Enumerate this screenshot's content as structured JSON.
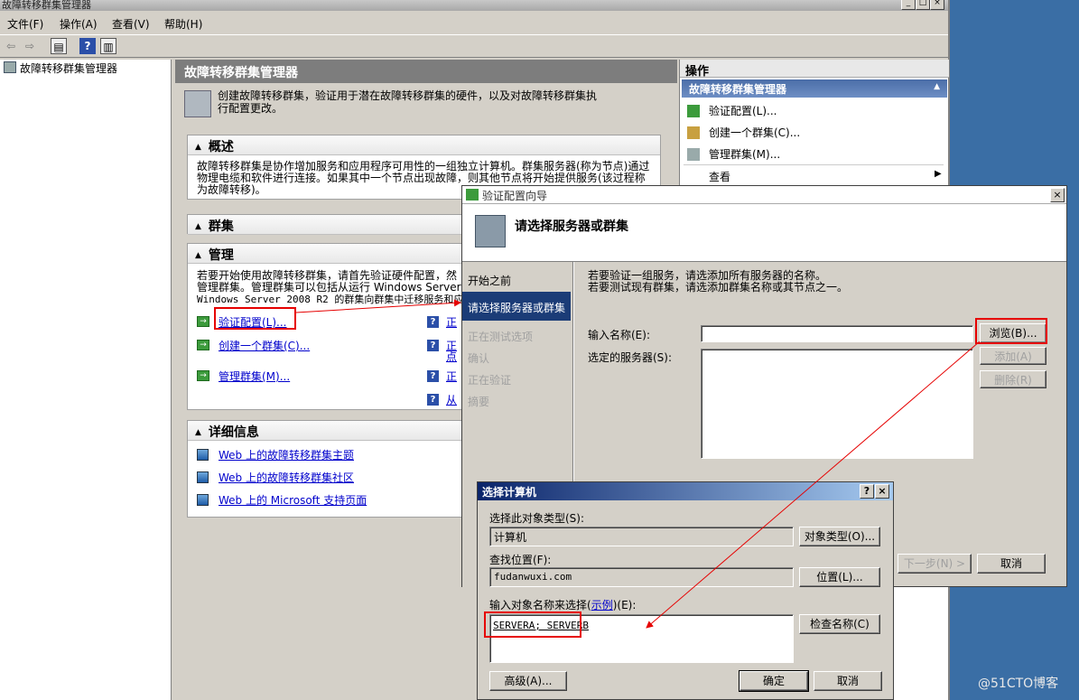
{
  "main_window": {
    "title": "故障转移群集管理器",
    "menu": [
      "文件(F)",
      "操作(A)",
      "查看(V)",
      "帮助(H)"
    ]
  },
  "tree": {
    "root": "故障转移群集管理器"
  },
  "center": {
    "header": "故障转移群集管理器",
    "intro": "创建故障转移群集，验证用于潜在故障转移群集的硬件，以及对故障转移群集执行配置更改。",
    "overview": {
      "title": "概述",
      "text": "故障转移群集是协作增加服务和应用程序可用性的一组独立计算机。群集服务器(称为节点)通过物理电缆和软件进行连接。如果其中一个节点出现故障，则其他节点将开始提供服务(该过程称为故障转移)。"
    },
    "cluster": {
      "title": "群集"
    },
    "manage": {
      "title": "管理",
      "text1": "若要开始使用故障转移群集，请首先验证硬件配置，然",
      "text2": "管理群集。管理群集可以包括从运行 Windows Server",
      "text3": "Windows Server 2008 R2 的群集向群集中迁移服务和应",
      "validate": "验证配置(L)...",
      "create": "创建一个群集(C)...",
      "manage_cluster": "管理群集(M)...",
      "right_links": [
        "正",
        "正",
        "点",
        "正",
        "从"
      ]
    },
    "details": {
      "title": "详细信息",
      "links": [
        "Web 上的故障转移群集主题",
        "Web 上的故障转移群集社区",
        "Web 上的 Microsoft 支持页面"
      ]
    }
  },
  "actions": {
    "header": "操作",
    "subheader": "故障转移群集管理器",
    "items": [
      "验证配置(L)...",
      "创建一个群集(C)...",
      "管理群集(M)...",
      "查看"
    ]
  },
  "wizard": {
    "title": "验证配置向导",
    "heading": "请选择服务器或群集",
    "nav": [
      "开始之前",
      "请选择服务器或群集",
      "正在测试选项",
      "确认",
      "正在验证",
      "摘要"
    ],
    "instruction1": "若要验证一组服务，请选添加所有服务器的名称。",
    "instruction2": "若要测试现有群集，请选添加群集名称或其节点之一。",
    "name_label": "输入名称(E):",
    "selected_label": "选定的服务器(S):",
    "browse": "浏览(B)...",
    "add": "添加(A)",
    "remove": "删除(R)",
    "next": "下一步(N) >",
    "cancel": "取消"
  },
  "select_computer": {
    "title": "选择计算机",
    "help": "?",
    "close": "×",
    "type_label": "选择此对象类型(S):",
    "type_value": "计算机",
    "type_button": "对象类型(O)...",
    "location_label": "查找位置(F):",
    "location_value": "fudanwuxi.com",
    "location_button": "位置(L)...",
    "names_label": "输入对象名称来选择(",
    "names_link": "示例",
    "names_label_end": ")(E):",
    "names_value": "SERVERA; SERVERB",
    "check_names": "检查名称(C)",
    "advanced": "高级(A)...",
    "ok": "确定",
    "cancel": "取消"
  },
  "watermark": "@51CTO博客"
}
